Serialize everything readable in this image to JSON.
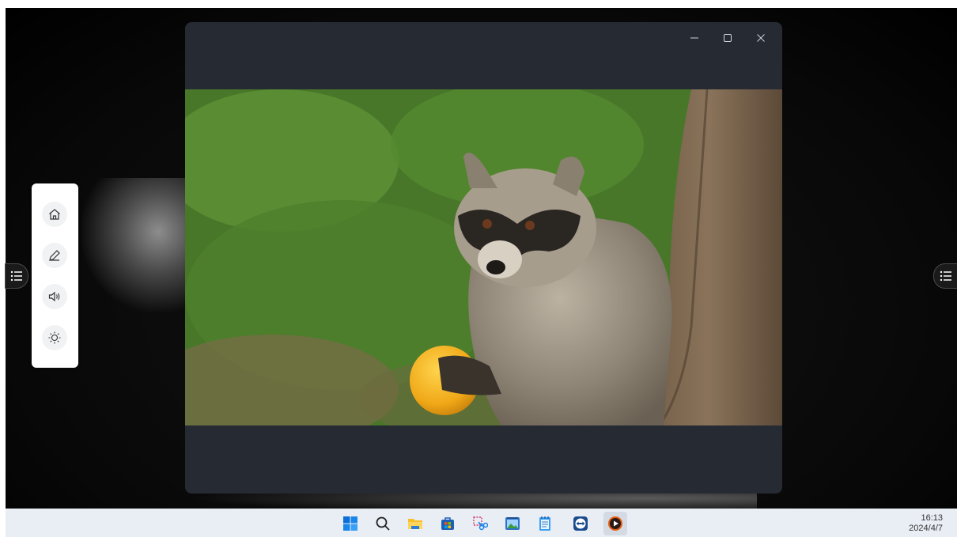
{
  "window": {
    "minimize_icon": "minimize-icon",
    "maximize_icon": "maximize-icon",
    "close_icon": "close-icon"
  },
  "tool_panel": {
    "items": [
      {
        "name": "home",
        "icon": "home-icon"
      },
      {
        "name": "pen",
        "icon": "pen-icon"
      },
      {
        "name": "volume",
        "icon": "volume-icon"
      },
      {
        "name": "brightness",
        "icon": "brightness-icon"
      }
    ]
  },
  "side_handles": {
    "icon": "menu-list-icon"
  },
  "taskbar": {
    "apps": [
      {
        "name": "start",
        "icon": "windows-start-icon"
      },
      {
        "name": "search",
        "icon": "search-icon"
      },
      {
        "name": "file-explorer",
        "icon": "folder-icon"
      },
      {
        "name": "store",
        "icon": "store-icon"
      },
      {
        "name": "snipping-tool",
        "icon": "scissors-icon"
      },
      {
        "name": "media-viewer",
        "icon": "media-viewer-icon"
      },
      {
        "name": "notepad",
        "icon": "notepad-icon"
      },
      {
        "name": "teamviewer",
        "icon": "teamviewer-icon"
      },
      {
        "name": "media-player",
        "icon": "media-player-icon"
      }
    ],
    "time": "16:13",
    "date": "2024/4/7"
  },
  "colors": {
    "player_bg": "#252a33",
    "taskbar_bg": "#e9eef5",
    "panel_bg": "#ffffff"
  }
}
